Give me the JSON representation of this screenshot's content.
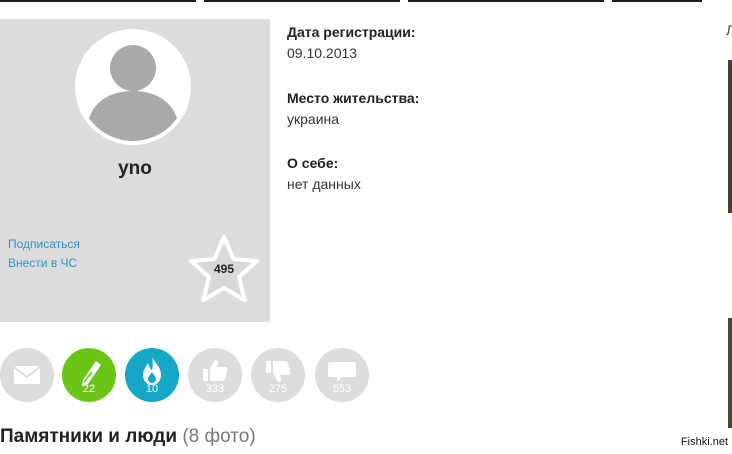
{
  "profile": {
    "username": "yno",
    "subscribe_label": "Подписаться",
    "blacklist_label": "Внести в ЧС",
    "rating": "495"
  },
  "info": {
    "registration": {
      "label": "Дата регистрации:",
      "value": "09.10.2013"
    },
    "location": {
      "label": "Место жительства:",
      "value": "украина"
    },
    "about": {
      "label": "О себе:",
      "value": "нет данных"
    }
  },
  "actions": [
    {
      "icon": "envelope-icon",
      "count": "",
      "color": "#dcdcdc"
    },
    {
      "icon": "pen-icon",
      "count": "22",
      "color": "#6cc417"
    },
    {
      "icon": "flame-icon",
      "count": "10",
      "color": "#17a7c6"
    },
    {
      "icon": "thumbs-up-icon",
      "count": "333",
      "color": "#dcdcdc"
    },
    {
      "icon": "thumbs-down-icon",
      "count": "275",
      "color": "#dcdcdc"
    },
    {
      "icon": "speech-bubble-icon",
      "count": "553",
      "color": "#dcdcdc"
    }
  ],
  "section": {
    "title": "Памятники и люди",
    "count": "(8 фото)"
  },
  "sidebar_fragment": "Л",
  "watermark": "Fishki.net"
}
